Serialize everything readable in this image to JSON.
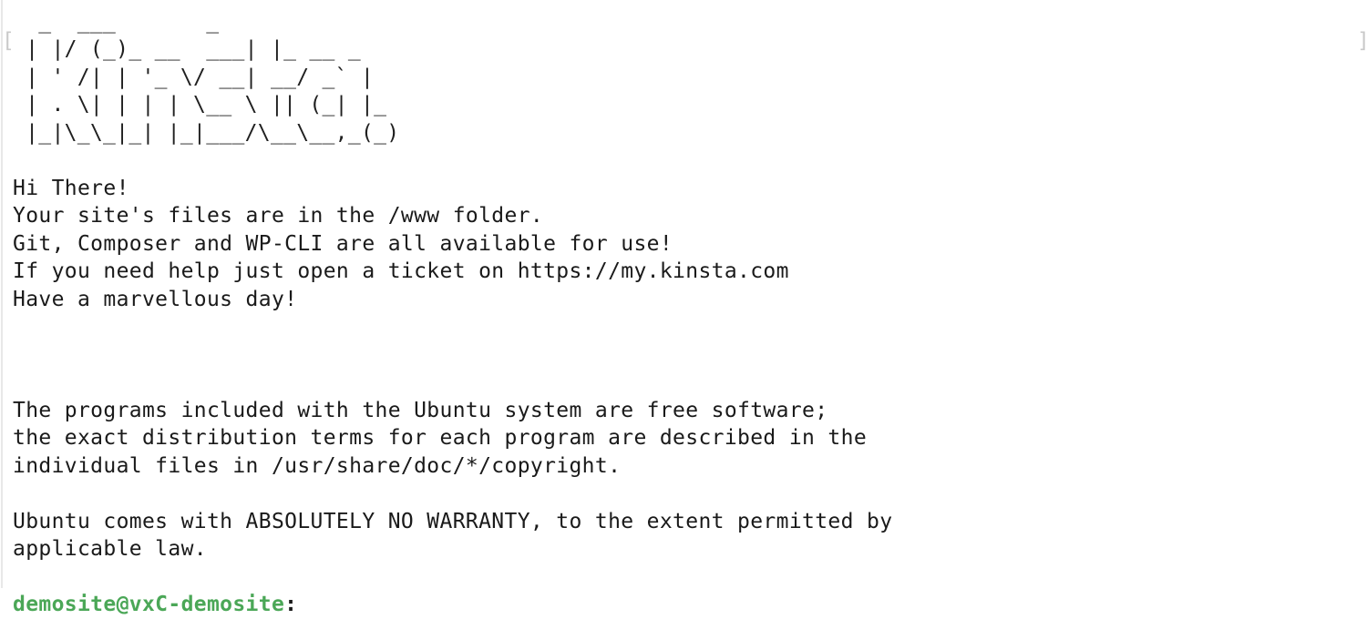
{
  "window": {
    "type": "terminal",
    "background_color": "#ffffff",
    "text_color": "#1a1a1a",
    "prompt_color": "#4ba757",
    "bracket_color": "#c9c9c9"
  },
  "decorations": {
    "left_bracket": "[",
    "right_bracket": "]"
  },
  "banner": {
    "ascii_art": [
      "  _  ___       _",
      " | |/ (_)_ __  ___| |_ __ _",
      " | ' /| | '_ \\/ __| __/ _` |",
      " | . \\| | | | \\__ \\ || (_| |_",
      " |_|\\_\\_|_| |_|___/\\__\\__,_(_)"
    ],
    "greeting_lines": [
      "Hi There!",
      "Your site's files are in the /www folder.",
      "Git, Composer and WP-CLI are all available for use!",
      "If you need help just open a ticket on https://my.kinsta.com",
      "Have a marvellous day!"
    ],
    "legal_lines": [
      "The programs included with the Ubuntu system are free software;",
      "the exact distribution terms for each program are described in the",
      "individual files in /usr/share/doc/*/copyright."
    ],
    "warranty_lines": [
      "Ubuntu comes with ABSOLUTELY NO WARRANTY, to the extent permitted by",
      "applicable law."
    ]
  },
  "prompt": {
    "user_host": "demosite@vxC-demosite",
    "separator": ":",
    "path": "",
    "input": ""
  }
}
